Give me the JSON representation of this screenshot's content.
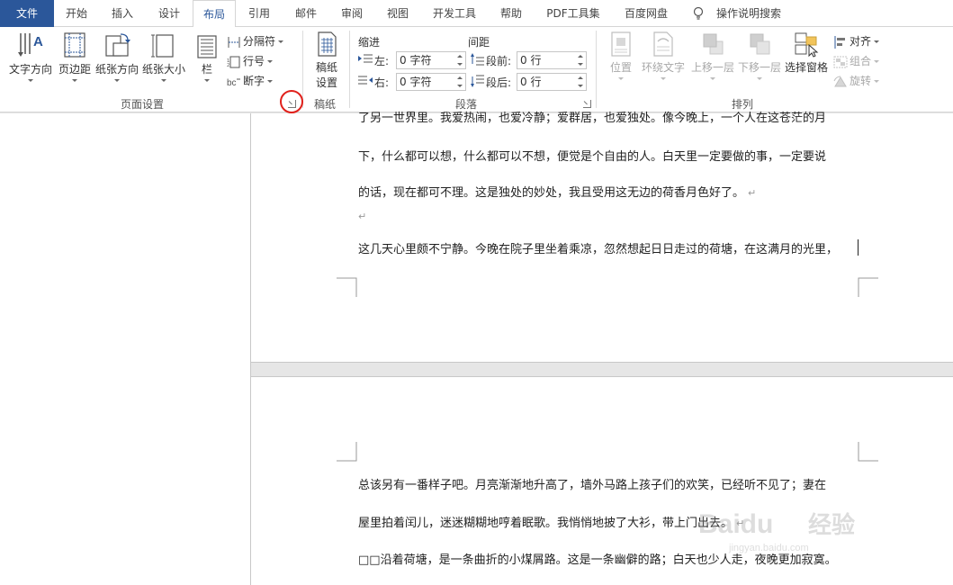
{
  "tabs": [
    {
      "label": "文件",
      "name": "tab-file"
    },
    {
      "label": "开始",
      "name": "tab-home"
    },
    {
      "label": "插入",
      "name": "tab-insert"
    },
    {
      "label": "设计",
      "name": "tab-design"
    },
    {
      "label": "布局",
      "name": "tab-layout"
    },
    {
      "label": "引用",
      "name": "tab-references"
    },
    {
      "label": "邮件",
      "name": "tab-mailings"
    },
    {
      "label": "审阅",
      "name": "tab-review"
    },
    {
      "label": "视图",
      "name": "tab-view"
    },
    {
      "label": "开发工具",
      "name": "tab-developer"
    },
    {
      "label": "帮助",
      "name": "tab-help"
    },
    {
      "label": "PDF工具集",
      "name": "tab-pdf-tools"
    },
    {
      "label": "百度网盘",
      "name": "tab-baidu-netdisk"
    }
  ],
  "search": {
    "label": "操作说明搜索",
    "icon": "lightbulb-icon"
  },
  "ribbon": {
    "page_setup": {
      "group_label": "页面设置",
      "text_direction": "文字方向",
      "margins": "页边距",
      "orientation": "纸张方向",
      "size": "纸张大小",
      "columns": "栏",
      "breaks": "分隔符",
      "line_numbers": "行号",
      "hyphenation": "断字"
    },
    "manuscript": {
      "group_label": "稿纸",
      "button_line1": "稿纸",
      "button_line2": "设置"
    },
    "paragraph": {
      "group_label": "段落",
      "indent_header": "缩进",
      "spacing_header": "间距",
      "left_label": "左:",
      "left_value": "0 字符",
      "right_label": "右:",
      "right_value": "0 字符",
      "before_label": "段前:",
      "before_value": "0 行",
      "after_label": "段后:",
      "after_value": "0 行"
    },
    "arrange": {
      "group_label": "排列",
      "position": "位置",
      "wrap_text": "环绕文字",
      "bring_forward": "上移一层",
      "send_backward": "下移一层",
      "selection_pane": "选择窗格",
      "align": "对齐",
      "group": "组合",
      "rotate": "旋转"
    }
  },
  "document": {
    "page1_lines": [
      "了另一世界里。我爱热闹，也爱冷静；爱群居，也爱独处。像今晚上，一个人在这苍茫的月",
      "下，什么都可以想，什么都可以不想，便觉是个自由的人。白天里一定要做的事，一定要说",
      "的话，现在都可不理。这是独处的妙处，我且受用这无边的荷香月色好了。",
      "",
      "这几天心里颇不宁静。今晚在院子里坐着乘凉，忽然想起日日走过的荷塘，在这满月的光里，"
    ],
    "paragraph_mark": "↵",
    "page2_lines": [
      "总该另有一番样子吧。月亮渐渐地升高了，墙外马路上孩子们的欢笑，已经听不见了；妻在",
      "屋里拍着闰儿，迷迷糊糊地哼着眠歌。我悄悄地披了大衫，带上门出去。",
      "□□沿着荷塘，是一条曲折的小煤屑路。这是一条幽僻的路；白天也少人走，夜晚更加寂寞。"
    ]
  },
  "watermark": {
    "brand": "Baidu",
    "suffix": "经验",
    "url": "jingyan.baidu.com"
  },
  "colors": {
    "accent": "#2b579a",
    "highlight_circle": "#e0201b"
  }
}
